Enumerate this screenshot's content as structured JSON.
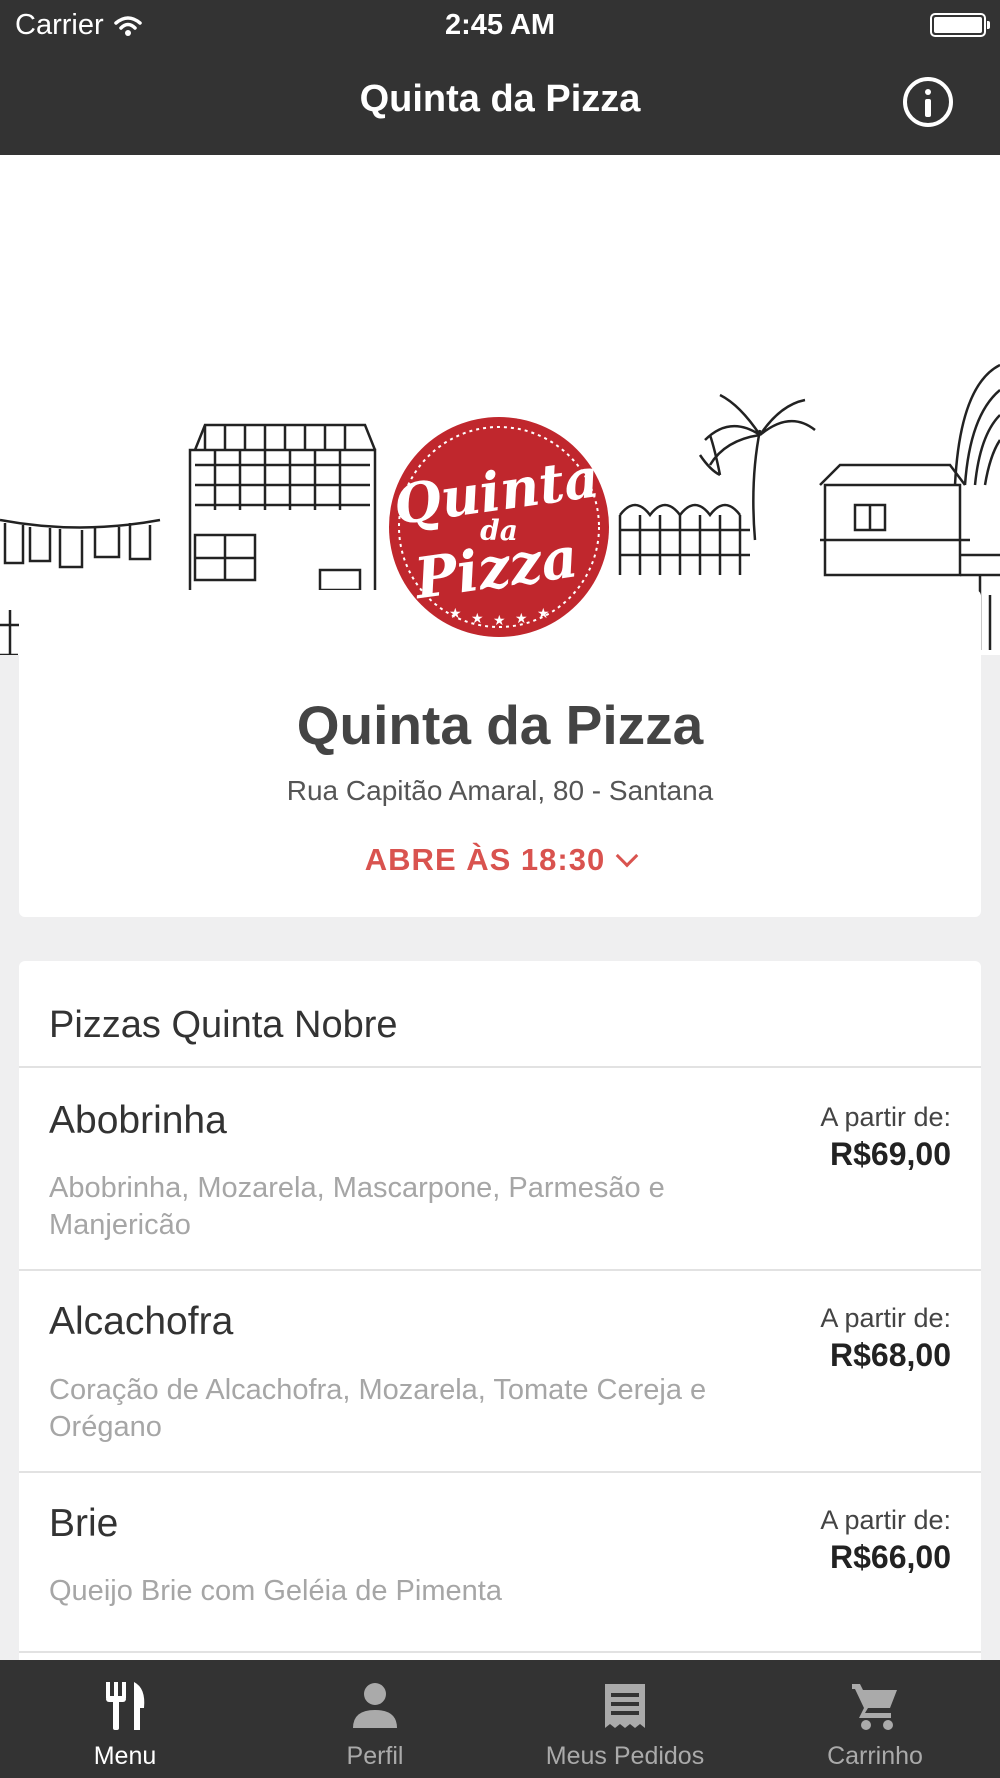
{
  "status_bar": {
    "carrier": "Carrier",
    "time": "2:45 AM"
  },
  "nav": {
    "title": "Quinta da Pizza"
  },
  "logo": {
    "text": [
      "Quinta",
      "da",
      "Pizza"
    ]
  },
  "store": {
    "name": "Quinta da Pizza",
    "address": "Rua Capitão Amaral, 80 - Santana",
    "open_status": "ABRE ÀS 18:30"
  },
  "menu": {
    "section_title": "Pizzas Quinta Nobre",
    "items": [
      {
        "name": "Abobrinha",
        "description": "Abobrinha, Mozarela, Mascarpone, Parmesão e Manjericão",
        "from_label": "A partir de:",
        "price": "R$69,00"
      },
      {
        "name": "Alcachofra",
        "description": "Coração de Alcachofra, Mozarela, Tomate Cereja e Orégano",
        "from_label": "A partir de:",
        "price": "R$68,00"
      },
      {
        "name": "Brie",
        "description": "Queijo Brie com Geléia de Pimenta",
        "from_label": "A partir de:",
        "price": "R$66,00"
      }
    ]
  },
  "tabs": [
    {
      "label": "Menu",
      "icon": "fork-knife-icon",
      "active": true
    },
    {
      "label": "Perfil",
      "icon": "person-icon",
      "active": false
    },
    {
      "label": "Meus Pedidos",
      "icon": "receipt-icon",
      "active": false
    },
    {
      "label": "Carrinho",
      "icon": "cart-icon",
      "active": false
    }
  ],
  "colors": {
    "bar": "#333333",
    "accent": "#d9534f",
    "logo_red": "#c0272d"
  }
}
